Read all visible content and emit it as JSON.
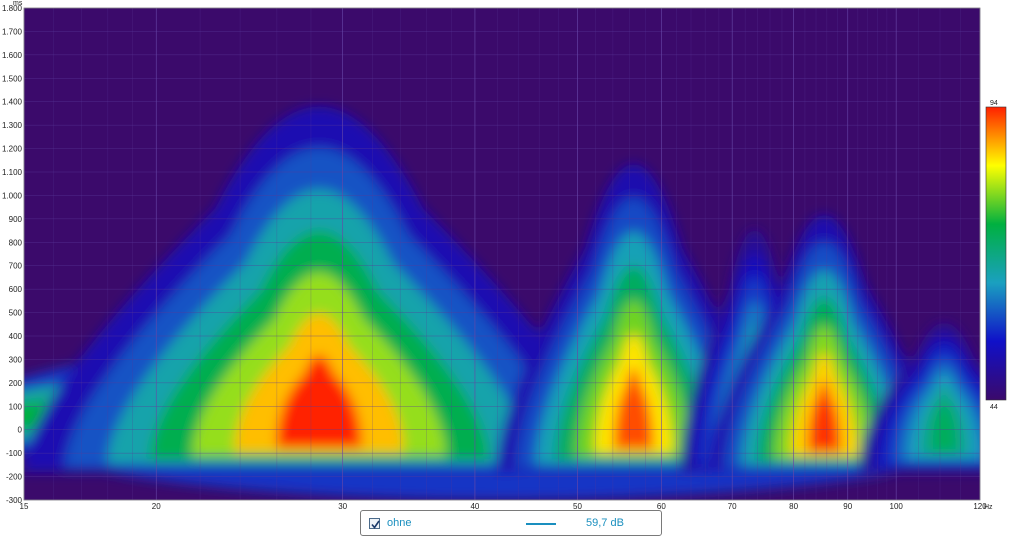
{
  "chart_data": {
    "type": "heatmap",
    "x_axis": {
      "scale": "log",
      "range": [
        15,
        120
      ],
      "unit": "Hz",
      "ticks": [
        15,
        20,
        30,
        40,
        50,
        60,
        70,
        80,
        90,
        100,
        120
      ]
    },
    "y_axis": {
      "scale": "linear",
      "range": [
        -300,
        1800
      ],
      "unit": "ms",
      "ticks": [
        {
          "v": -300,
          "label": "-300"
        },
        {
          "v": -200,
          "label": "-200"
        },
        {
          "v": -100,
          "label": "-100"
        },
        {
          "v": 0,
          "label": "0"
        },
        {
          "v": 100,
          "label": "100"
        },
        {
          "v": 200,
          "label": "200"
        },
        {
          "v": 300,
          "label": "300"
        },
        {
          "v": 400,
          "label": "400"
        },
        {
          "v": 500,
          "label": "500"
        },
        {
          "v": 600,
          "label": "600"
        },
        {
          "v": 700,
          "label": "700"
        },
        {
          "v": 800,
          "label": "800"
        },
        {
          "v": 900,
          "label": "900"
        },
        {
          "v": 1000,
          "label": "1.000"
        },
        {
          "v": 1100,
          "label": "1.100"
        },
        {
          "v": 1200,
          "label": "1.200"
        },
        {
          "v": 1300,
          "label": "1.300"
        },
        {
          "v": 1400,
          "label": "1.400"
        },
        {
          "v": 1500,
          "label": "1.500"
        },
        {
          "v": 1600,
          "label": "1.600"
        },
        {
          "v": 1700,
          "label": "1.700"
        },
        {
          "v": 1800,
          "label": "1.800"
        }
      ]
    },
    "color_scale": {
      "min": 44,
      "max": 94,
      "colors": [
        "#3b0a6b",
        "#1010c8",
        "#1aa0c0",
        "#00b040",
        "#ffff00",
        "#ff2000"
      ]
    },
    "background_color": "#3b0a6b",
    "grid": true,
    "features": [
      {
        "freq": 28.5,
        "time": 120,
        "level": 94,
        "width_oct": 0.28,
        "height_ms": 1650
      },
      {
        "freq": 56.5,
        "time": 100,
        "level": 92,
        "width_oct": 0.13,
        "height_ms": 1350
      },
      {
        "freq": 73.5,
        "time": 120,
        "level": 74,
        "width_oct": 0.07,
        "height_ms": 950
      },
      {
        "freq": 85.5,
        "time": 70,
        "level": 93,
        "width_oct": 0.11,
        "height_ms": 1100
      },
      {
        "freq": 111.0,
        "time": 60,
        "level": 72,
        "width_oct": 0.08,
        "height_ms": 500
      }
    ],
    "series": [
      {
        "name": "ohne",
        "value_label": "59,7 dB",
        "color": "#1a8fbf",
        "enabled": true
      }
    ]
  }
}
